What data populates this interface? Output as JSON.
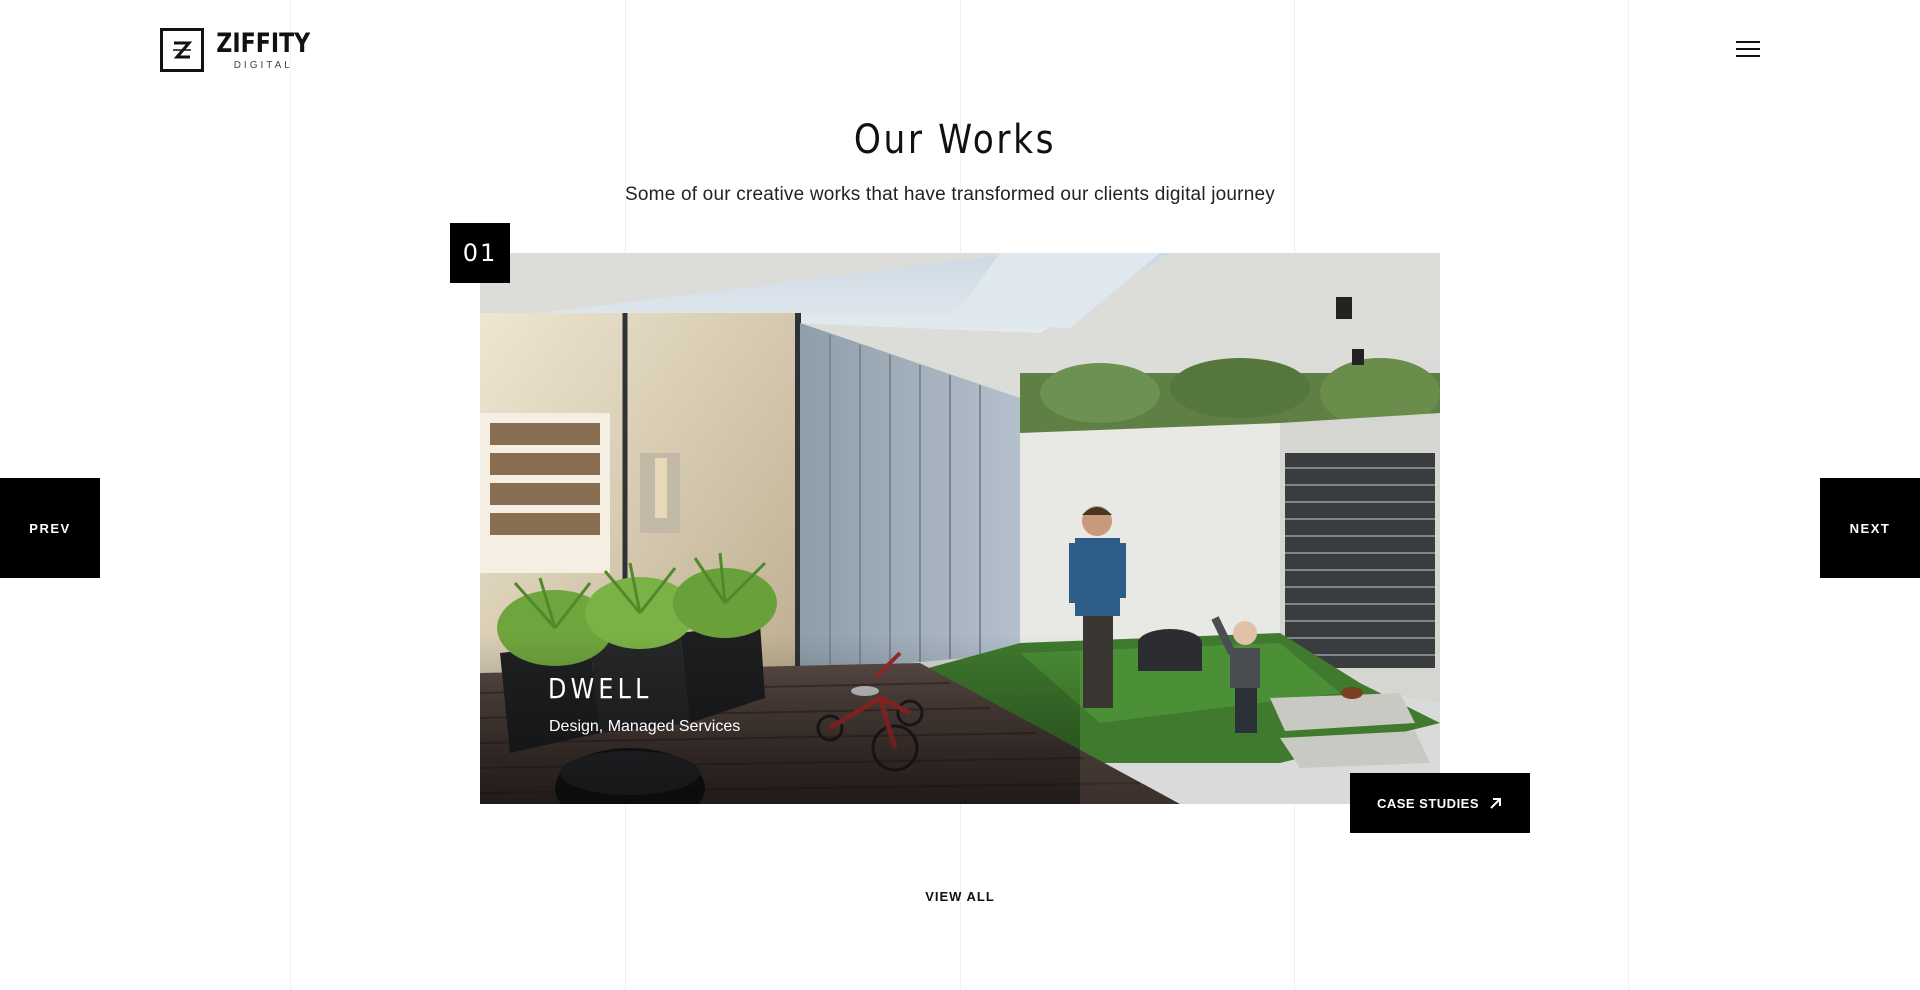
{
  "header": {
    "logo_main": "ZIFFITY",
    "logo_sub": "DIGITAL",
    "logo_mark": "Z",
    "menu_icon": "hamburger-menu-icon"
  },
  "section": {
    "title": "Our Works",
    "subtitle": "Some of our creative works that have transformed our clients digital journey"
  },
  "slider": {
    "current_index": "01",
    "prev_label": "PREV",
    "next_label": "NEXT",
    "slide": {
      "title": "DWELL",
      "tags": "Design, Managed Services",
      "image_description_icon": "project-photo",
      "cta_label": "CASE STUDIES",
      "cta_icon": "arrow-up-right-icon"
    }
  },
  "footer_link": {
    "view_all_label": "VIEW ALL"
  },
  "colors": {
    "background": "#ffffff",
    "text": "#111111",
    "button_bg": "#000000",
    "button_text": "#ffffff",
    "gridline": "#f0f0f0"
  }
}
